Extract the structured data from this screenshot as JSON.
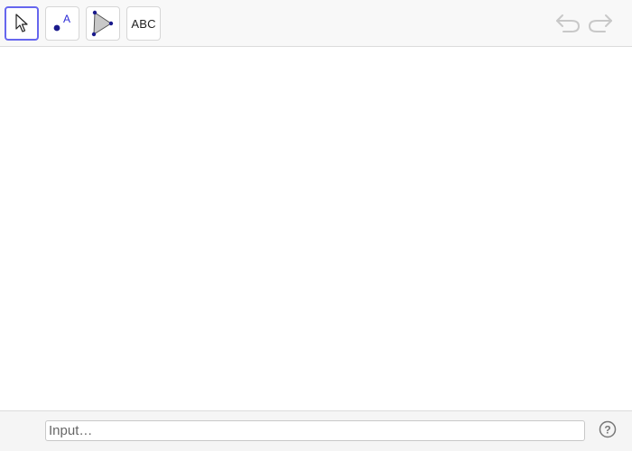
{
  "toolbar": {
    "tools": [
      {
        "id": "move",
        "icon": "cursor-arrow-icon",
        "selected": true
      },
      {
        "id": "point",
        "icon": "point-icon",
        "label": "A"
      },
      {
        "id": "polygon",
        "icon": "triangle-icon"
      },
      {
        "id": "text",
        "icon": "text-icon",
        "label": "ABC"
      }
    ],
    "undo_icon": "undo-icon",
    "redo_icon": "redo-icon"
  },
  "input_bar": {
    "placeholder": "Input…",
    "value": "",
    "help_icon": "help-icon"
  },
  "colors": {
    "selected_border": "#6666ee",
    "point_color": "#1a1a8c",
    "disabled_icon": "#c8c8c8"
  }
}
